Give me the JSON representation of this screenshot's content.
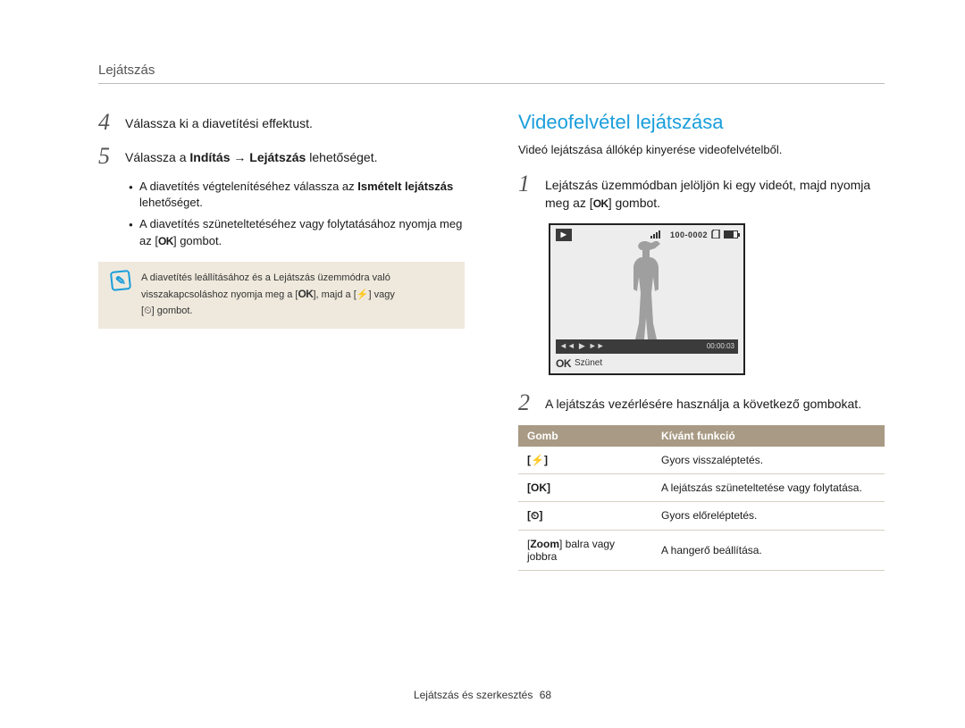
{
  "page_header": "Lejátszás",
  "left": {
    "step4_num": "4",
    "step4_text": "Válassza ki a diavetítési effektust.",
    "step5_num": "5",
    "step5_pre": "Válassza a ",
    "step5_bold": "Indítás → Lejátszás",
    "step5_post": " lehetőséget.",
    "bullet1_pre": "A diavetítés végtelenítéséhez válassza az ",
    "bullet1_bold": "Ismételt lejátszás",
    "bullet1_post": " lehetőséget.",
    "bullet2_pre": "A diavetítés szüneteltetéséhez vagy folytatásához nyomja meg az [",
    "bullet2_ok": "OK",
    "bullet2_post": "] gombot.",
    "note_line1": "A diavetítés leállításához és a Lejátszás üzemmódra való",
    "note_line2_pre": "visszakapcsoláshoz nyomja meg a [",
    "note_line2_ok": "OK",
    "note_line2_mid": "], majd a [",
    "note_line2_flash": "⚡",
    "note_line2_or": "] vagy",
    "note_line3": "[",
    "note_line3_timer": "⏲",
    "note_line3_end": "] gombot."
  },
  "right": {
    "title": "Videofelvétel lejátszása",
    "intro": "Videó lejátszása állókép kinyerése videofelvételből.",
    "step1_num": "1",
    "step1_line1": "Lejátszás üzemmódban jelöljön ki egy videót, majd nyomja",
    "step1_line2_pre": "meg az [",
    "step1_line2_ok": "OK",
    "step1_line2_post": "] gombot.",
    "thumb": {
      "folder_count": "100-0002",
      "time": "00:00:03",
      "bar_ok": "OK",
      "bar_label": "Szünet"
    },
    "step2_num": "2",
    "step2_text": "A lejátszás vezérlésére használja a következő gombokat.",
    "table": {
      "h1": "Gomb",
      "h2": "Kívánt funkció",
      "rows": [
        {
          "btn": "[⚡]",
          "fn": "Gyors visszaléptetés."
        },
        {
          "btn": "[OK]",
          "fn": "A lejátszás szüneteltetése vagy folytatása."
        },
        {
          "btn": "[⏲]",
          "fn": "Gyors előreléptetés."
        },
        {
          "btn_pre": "[",
          "btn_bold": "Zoom",
          "btn_post": "] balra vagy jobbra",
          "fn": "A hangerő beállítása."
        }
      ]
    }
  },
  "footer_text": "Lejátszás és szerkesztés",
  "footer_page": "68"
}
